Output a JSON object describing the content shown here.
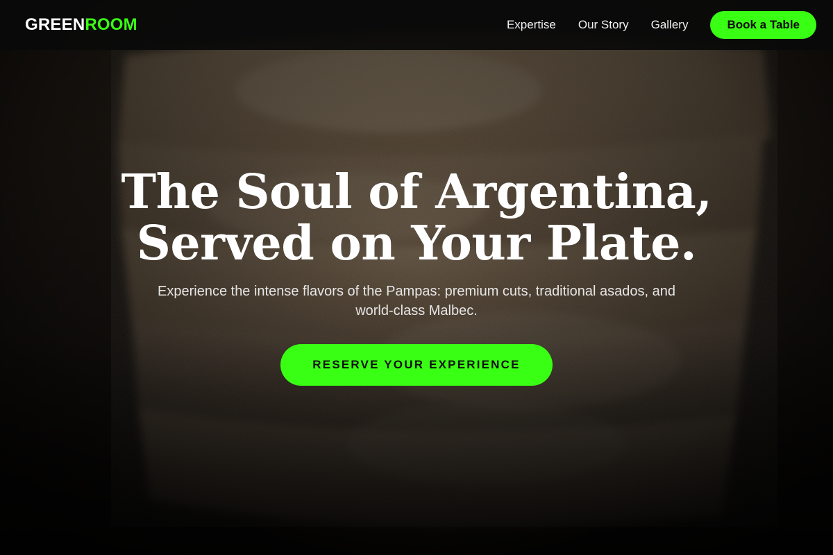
{
  "brand": {
    "logo_part_1": "GREEN",
    "logo_part_2": "ROOM",
    "accent_color": "#39ff14"
  },
  "nav": {
    "links": [
      {
        "label": "Expertise"
      },
      {
        "label": "Our Story"
      },
      {
        "label": "Gallery"
      }
    ],
    "cta_label": "Book a Table"
  },
  "hero": {
    "title_line_1": "The Soul of Argentina,",
    "title_line_2": "Served on Your Plate.",
    "subtitle_line_1": "Experience the intense flavors of the Pampas: premium cuts, traditional asados, and",
    "subtitle_line_2": "world-class Malbec.",
    "cta_label": "RESERVE YOUR EXPERIENCE",
    "background_image": "bread-stack-photo"
  }
}
